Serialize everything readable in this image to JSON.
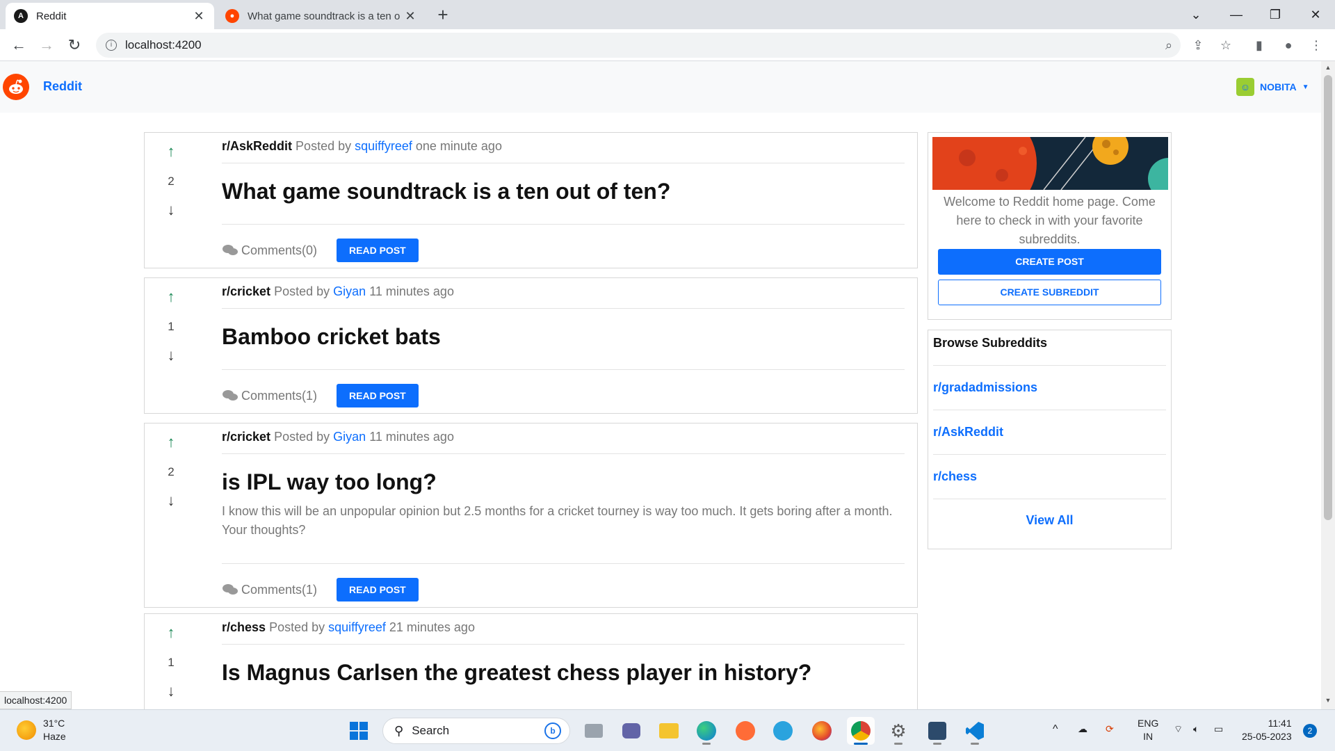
{
  "browser": {
    "tabs": [
      {
        "title": "Reddit",
        "active": true
      },
      {
        "title": "What game soundtrack is a ten o",
        "active": false
      }
    ],
    "url": "localhost:4200",
    "status_url": "localhost:4200"
  },
  "app": {
    "brand": "Reddit",
    "user": "NOBITA"
  },
  "posts": [
    {
      "subreddit": "r/AskReddit",
      "posted_by_label": "Posted by",
      "author": "squiffyreef",
      "time": "one minute ago",
      "votes": "2",
      "title": "What game soundtrack is a ten out of ten?",
      "body": "",
      "comments": "Comments(0)",
      "read_label": "READ POST"
    },
    {
      "subreddit": "r/cricket",
      "posted_by_label": "Posted by",
      "author": "Giyan",
      "time": "11 minutes ago",
      "votes": "1",
      "title": "Bamboo cricket bats",
      "body": "",
      "comments": "Comments(1)",
      "read_label": "READ POST"
    },
    {
      "subreddit": "r/cricket",
      "posted_by_label": "Posted by",
      "author": "Giyan",
      "time": "11 minutes ago",
      "votes": "2",
      "title": "is IPL way too long?",
      "body": "I know this will be an unpopular opinion but 2.5 months for a cricket tourney is way too much. It gets boring after a month. Your thoughts?",
      "comments": "Comments(1)",
      "read_label": "READ POST"
    },
    {
      "subreddit": "r/chess",
      "posted_by_label": "Posted by",
      "author": "squiffyreef",
      "time": "21 minutes ago",
      "votes": "1",
      "title": "Is Magnus Carlsen the greatest chess player in history?",
      "body": "",
      "comments": "",
      "read_label": ""
    }
  ],
  "sidebar": {
    "welcome": "Welcome to Reddit home page. Come here to check in with your favorite subreddits.",
    "create_post": "CREATE POST",
    "create_subreddit": "CREATE SUBREDDIT",
    "browse_title": "Browse Subreddits",
    "subreddits": [
      "r/gradadmissions",
      "r/AskReddit",
      "r/chess"
    ],
    "view_all": "View All"
  },
  "taskbar": {
    "temperature": "31°C",
    "weather": "Haze",
    "search_placeholder": "Search",
    "lang": "ENG",
    "region": "IN",
    "time": "11:41",
    "date": "25-05-2023",
    "notifications": "2"
  },
  "colors": {
    "accent": "#0d6efd",
    "upvote": "#198754",
    "reddit_orange": "#ff4500"
  }
}
